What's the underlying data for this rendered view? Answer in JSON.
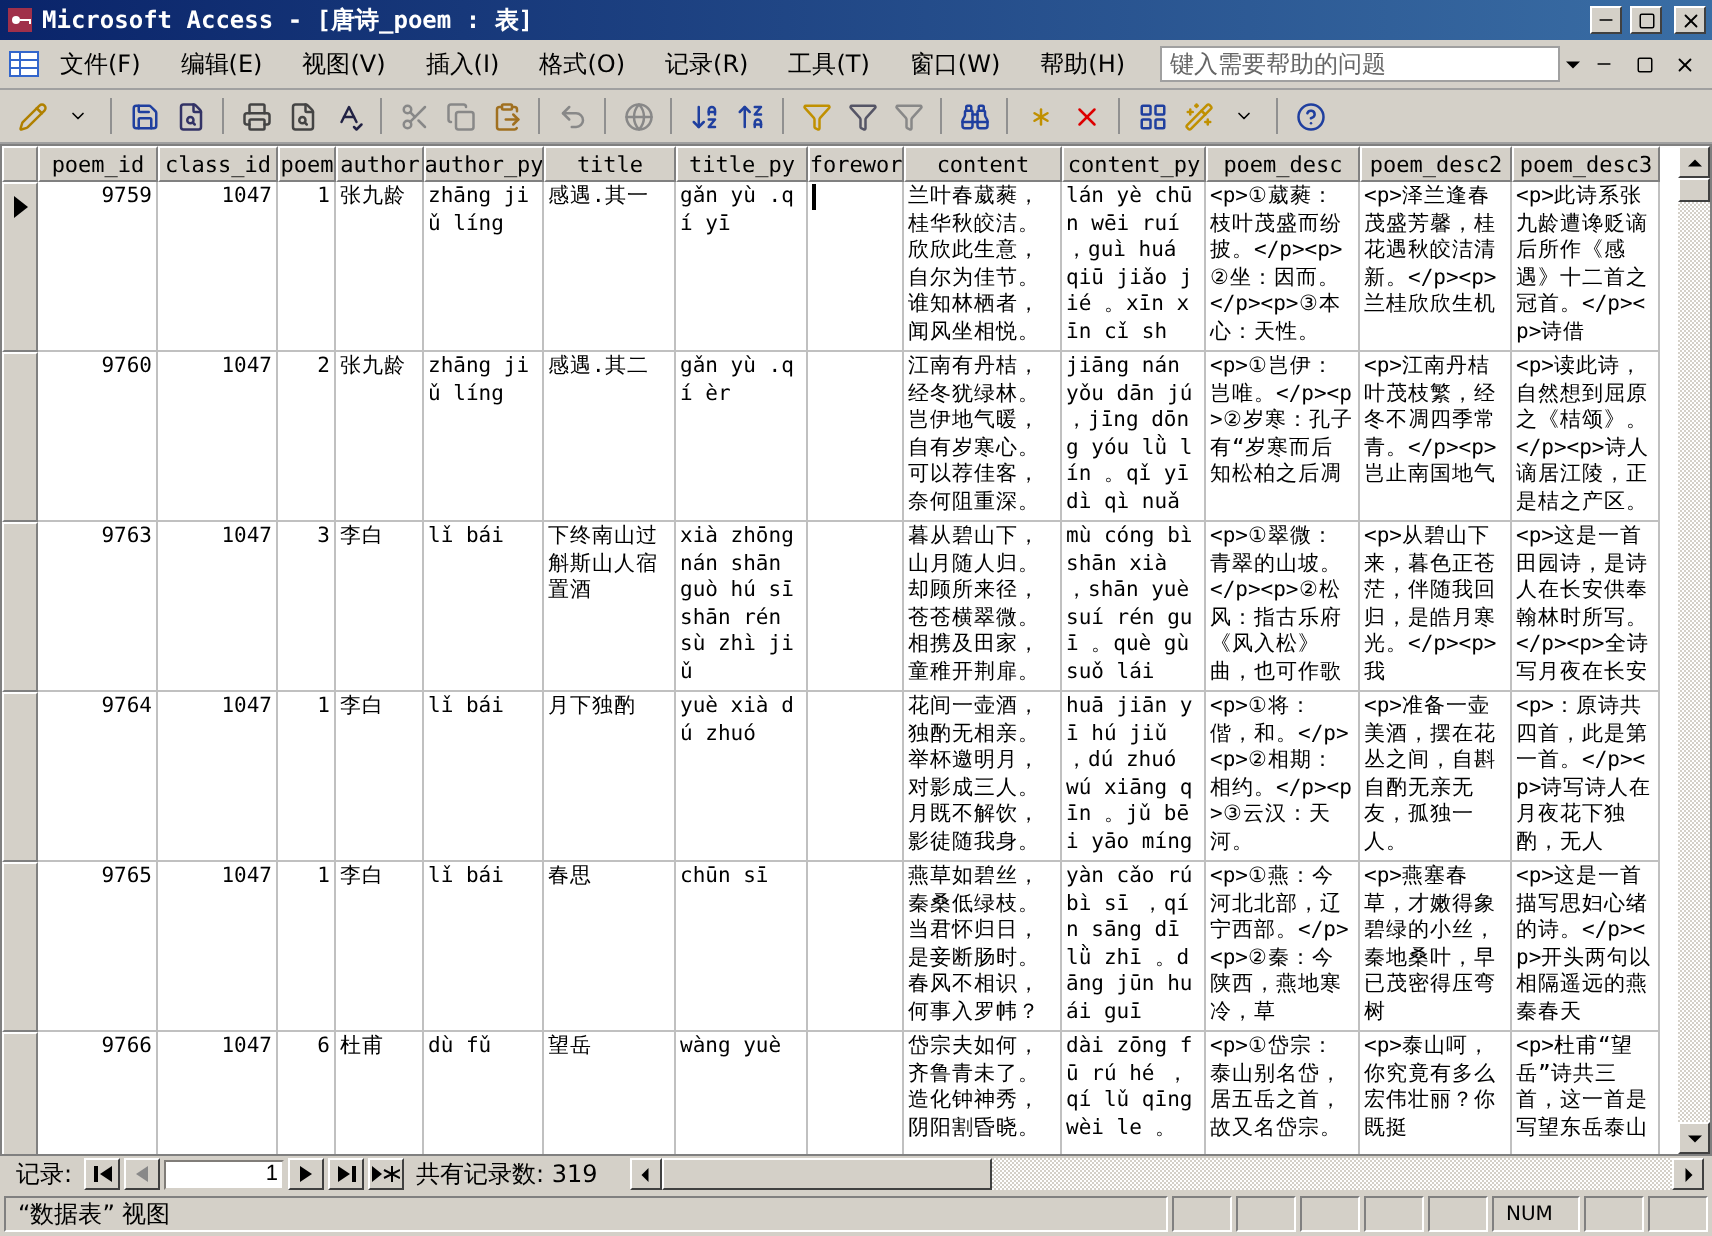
{
  "window": {
    "title": "Microsoft Access - [唐诗_poem : 表]"
  },
  "menu": [
    "文件(F)",
    "编辑(E)",
    "视图(V)",
    "插入(I)",
    "格式(O)",
    "记录(R)",
    "工具(T)",
    "窗口(W)",
    "帮助(H)"
  ],
  "help_box": {
    "placeholder": "键入需要帮助的问题"
  },
  "table": {
    "columns": [
      "poem_id",
      "class_id",
      "poem",
      "author",
      "author_py",
      "title",
      "title_py",
      "forewor",
      "content",
      "content_py",
      "poem_desc",
      "poem_desc2",
      "poem_desc3"
    ],
    "rows": [
      {
        "selected": true,
        "cells": [
          "9759",
          "1047",
          "1",
          "张九龄",
          "zhāng jiǔ líng",
          "感遇.其一",
          "gǎn yù .qí yī",
          "",
          "兰叶春葳蕤，桂华秋皎洁。欣欣此生意，自尔为佳节。谁知林栖者，闻风坐相悦。",
          "lán yè chūn wēi ruí ，guì huá qiū jiǎo jié 。xīn xīn cǐ sh",
          "<p>①葳蕤：枝叶茂盛而纷披。</p><p>②坐：因而。</p><p>③本心：天性。",
          "<p>泽兰逢春茂盛芳馨，桂花遇秋皎洁清新。</p><p> 兰桂欣欣生机",
          "<p>此诗系张九龄遭谗贬谪后所作《感遇》十二首之冠首。</p><p>诗借"
        ]
      },
      {
        "selected": false,
        "cells": [
          "9760",
          "1047",
          "2",
          "张九龄",
          "zhāng jiǔ líng",
          "感遇.其二",
          "gǎn yù .qí èr",
          "",
          "江南有丹桔，经冬犹绿林。岂伊地气暖，自有岁寒心。可以荐佳客，奈何阻重深。",
          "jiāng nán yǒu dān jú ，jīng dōng yóu lǜ lín 。qǐ yī dì qì nuǎ",
          "<p>①岂伊：岂唯。</p><p>②岁寒：孔子有“岁寒而后知松柏之后凋",
          "<p>江南丹桔叶茂枝繁，经冬不凋四季常青。</p><p> 岂止南国地气",
          "<p>读此诗，自然想到屈原之《桔颂》。</p><p>诗人谪居江陵，正是桔之产区。"
        ]
      },
      {
        "selected": false,
        "cells": [
          "9763",
          "1047",
          "3",
          "李白",
          "lǐ bái",
          "下终南山过斛斯山人宿置酒",
          "xià zhōng nán shān guò hú sī shān rén sù zhì jiǔ",
          "",
          "暮从碧山下，山月随人归。却顾所来径，苍苍横翠微。相携及田家，童稚开荆扉。",
          "mù cóng bì shān xià ，shān yuè suí rén guī 。què gù suǒ lái",
          "<p>①翠微：青翠的山坡。</p><p>②松风：指古乐府《风入松》曲，也可作歌",
          "<p>从碧山下来，暮色正苍茫，伴随我回归，是皓月寒光。</p><p> 我",
          "<p>这是一首田园诗，是诗人在长安供奉翰林时所写。</p><p>全诗写月夜在长安"
        ]
      },
      {
        "selected": false,
        "cells": [
          "9764",
          "1047",
          "1",
          "李白",
          "lǐ bái",
          "月下独酌",
          "yuè xià dú zhuó",
          "",
          "花间一壶酒，独酌无相亲。举杯邀明月，对影成三人。月既不解饮，影徒随我身。",
          "huā jiān yī hú jiǔ ，dú zhuó wú xiāng qīn 。jǔ bēi yāo míng",
          "<p>①将：偕，和。</p><p>②相期：相约。</p><p>③云汉：天河。",
          "<p>准备一壶美酒，摆在花丛之间，自斟自酌无亲无友，孤独一人。",
          "<p>：原诗共四首，此是第一首。</p><p>诗写诗人在月夜花下独酌，无人"
        ]
      },
      {
        "selected": false,
        "cells": [
          "9765",
          "1047",
          "1",
          "李白",
          "lǐ bái",
          "春思",
          "chūn sī",
          "",
          "燕草如碧丝，秦桑低绿枝。当君怀归日，是妾断肠时。春风不相识，何事入罗帏？",
          "yàn cǎo rú bì sī ，qín sāng dī lǜ zhī 。dāng jūn huái guī",
          "<p>①燕：今河北北部，辽宁西部。</p><p>②秦：今陕西，燕地寒冷，草",
          "<p>燕塞春草，才嫩得象碧绿的小丝，秦地桑叶，早已茂密得压弯树",
          "<p>这是一首描写思妇心绪的诗。</p><p>开头两句以相隔遥远的燕秦春天"
        ]
      },
      {
        "selected": false,
        "cells": [
          "9766",
          "1047",
          "6",
          "杜甫",
          "dù fǔ",
          "望岳",
          "wàng yuè",
          "",
          "岱宗夫如何，齐鲁青未了。造化钟神秀，阴阳割昏晓。",
          "dài zōng fū rú hé ，qí lǔ qīng wèi le 。",
          "<p>①岱宗：泰山别名岱，居五岳之首，故又名岱宗。",
          "<p>泰山呵，你究竟有多么宏伟壮丽？你既挺",
          "<p>杜甫“望岳”诗共三首，这一首是写望东岳泰山"
        ]
      }
    ]
  },
  "navigator": {
    "label": "记录:",
    "record": "1",
    "total": "共有记录数: 319"
  },
  "status_bar": {
    "view": "“数据表” 视图",
    "indicator": "NUM"
  }
}
